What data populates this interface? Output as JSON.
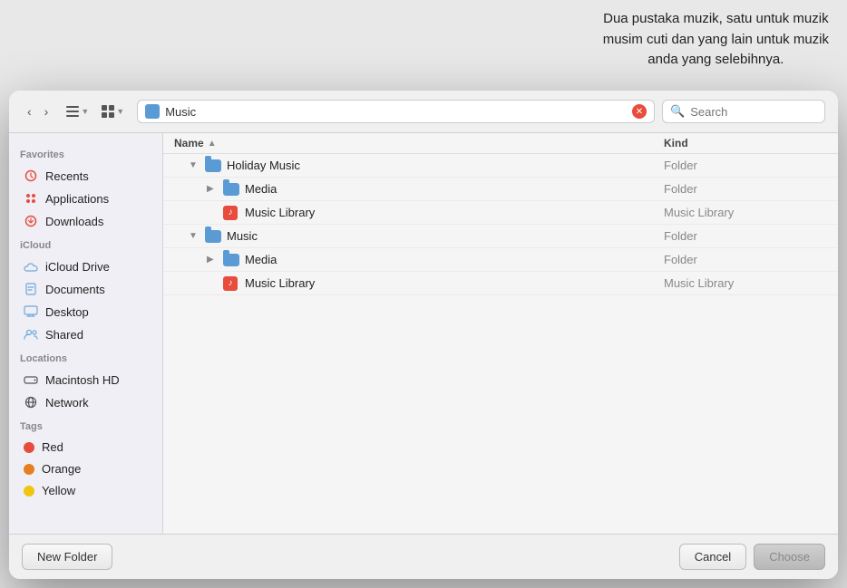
{
  "annotation": {
    "line1": "Dua pustaka muzik, satu untuk muzik",
    "line2": "musim cuti dan yang lain untuk muzik",
    "line3": "anda yang selebihnya."
  },
  "toolbar": {
    "location_name": "Music",
    "search_placeholder": "Search"
  },
  "sidebar": {
    "favorites_label": "Favorites",
    "icloud_label": "iCloud",
    "locations_label": "Locations",
    "tags_label": "Tags",
    "items": [
      {
        "id": "recents",
        "label": "Recents",
        "icon": "clock"
      },
      {
        "id": "applications",
        "label": "Applications",
        "icon": "grid"
      },
      {
        "id": "downloads",
        "label": "Downloads",
        "icon": "arrow-down-circle"
      },
      {
        "id": "icloud-drive",
        "label": "iCloud Drive",
        "icon": "cloud"
      },
      {
        "id": "documents",
        "label": "Documents",
        "icon": "doc"
      },
      {
        "id": "desktop",
        "label": "Desktop",
        "icon": "desktop"
      },
      {
        "id": "shared",
        "label": "Shared",
        "icon": "person-2"
      },
      {
        "id": "macintosh-hd",
        "label": "Macintosh HD",
        "icon": "hd"
      },
      {
        "id": "network",
        "label": "Network",
        "icon": "network"
      }
    ],
    "tags": [
      {
        "id": "red",
        "label": "Red",
        "color": "#e74c3c"
      },
      {
        "id": "orange",
        "label": "Orange",
        "color": "#e67e22"
      },
      {
        "id": "yellow",
        "label": "Yellow",
        "color": "#f1c40f"
      }
    ]
  },
  "file_list": {
    "col_name": "Name",
    "col_kind": "Kind",
    "rows": [
      {
        "id": "holiday-music",
        "indent": 1,
        "expanded": true,
        "type": "folder",
        "name": "Holiday Music",
        "kind": "Folder"
      },
      {
        "id": "media-1",
        "indent": 2,
        "expanded": false,
        "type": "folder",
        "name": "Media",
        "kind": "Folder"
      },
      {
        "id": "music-library-1",
        "indent": 2,
        "expanded": false,
        "type": "music-lib",
        "name": "Music Library",
        "kind": "Music Library"
      },
      {
        "id": "music",
        "indent": 1,
        "expanded": true,
        "type": "folder",
        "name": "Music",
        "kind": "Folder"
      },
      {
        "id": "media-2",
        "indent": 2,
        "expanded": false,
        "type": "folder",
        "name": "Media",
        "kind": "Folder"
      },
      {
        "id": "music-library-2",
        "indent": 2,
        "expanded": false,
        "type": "music-lib",
        "name": "Music Library",
        "kind": "Music Library"
      }
    ]
  },
  "bottom_bar": {
    "new_folder_label": "New Folder",
    "cancel_label": "Cancel",
    "choose_label": "Choose"
  }
}
